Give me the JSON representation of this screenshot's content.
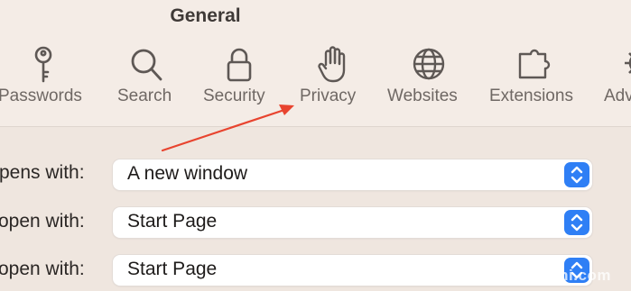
{
  "window": {
    "title": "General"
  },
  "tabs": [
    {
      "label": "Passwords",
      "icon": "key-icon"
    },
    {
      "label": "Search",
      "icon": "magnifier-icon"
    },
    {
      "label": "Security",
      "icon": "lock-icon"
    },
    {
      "label": "Privacy",
      "icon": "hand-icon"
    },
    {
      "label": "Websites",
      "icon": "globe-icon"
    },
    {
      "label": "Extensions",
      "icon": "puzzle-piece-icon"
    },
    {
      "label": "Adv",
      "icon": "gear-icon"
    }
  ],
  "settings": [
    {
      "label": "pens with:",
      "value": "A new window"
    },
    {
      "label": "open with:",
      "value": "Start Page"
    },
    {
      "label": "open with:",
      "value": "Start Page"
    }
  ],
  "annotation": {
    "color": "#e8442f",
    "points_to": "Privacy"
  },
  "colors": {
    "accent": "#2f7ff5",
    "toolbar_bg": "#f4ece6"
  },
  "watermark": {
    "text": "ishi.com"
  }
}
